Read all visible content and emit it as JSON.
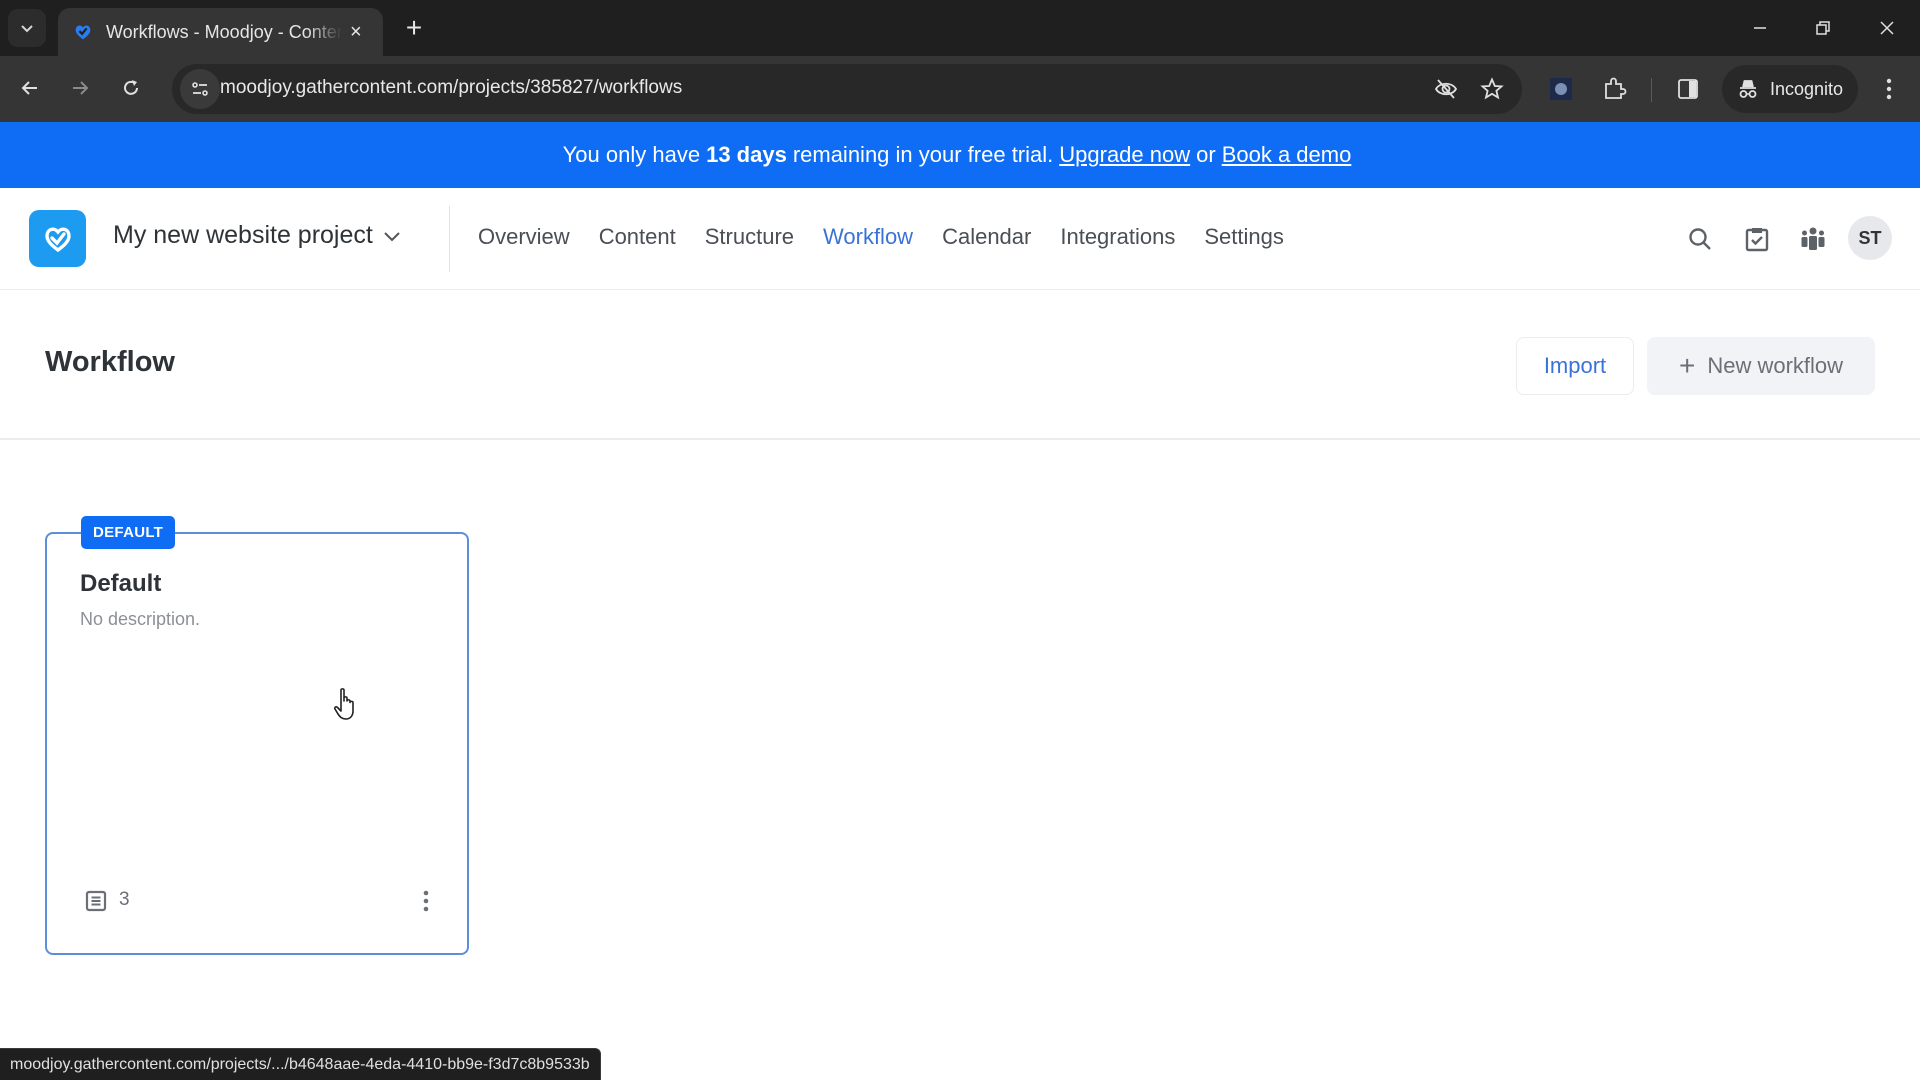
{
  "browser": {
    "tab": {
      "title": "Workflows - Moodjoy - Content",
      "close_label": "×"
    },
    "new_tab_label": "+",
    "url": "moodjoy.gathercontent.com/projects/385827/workflows",
    "incognito_label": "Incognito",
    "status_url": "moodjoy.gathercontent.com/projects/.../b4648aae-4eda-4410-bb9e-f3d7c8b9533b"
  },
  "banner": {
    "prefix": "You only have",
    "days": "13 days",
    "middle": "remaining in your free trial.",
    "upgrade_link": "Upgrade now",
    "or": "or",
    "demo_link": "Book a demo",
    "color": "#0f6cf4"
  },
  "header": {
    "project_name": "My new website project",
    "nav": [
      {
        "label": "Overview",
        "active": false
      },
      {
        "label": "Content",
        "active": false
      },
      {
        "label": "Structure",
        "active": false
      },
      {
        "label": "Workflow",
        "active": true
      },
      {
        "label": "Calendar",
        "active": false
      },
      {
        "label": "Integrations",
        "active": false
      },
      {
        "label": "Settings",
        "active": false
      }
    ],
    "icons": [
      "search-icon",
      "assignments-icon",
      "team-icon"
    ],
    "avatar_initials": "ST",
    "accent": "#3a73d6"
  },
  "page": {
    "title": "Workflow",
    "import_label": "Import",
    "new_workflow_label": "New workflow"
  },
  "workflows": [
    {
      "badge": "DEFAULT",
      "name": "Default",
      "description": "No description.",
      "item_count": "3"
    }
  ]
}
